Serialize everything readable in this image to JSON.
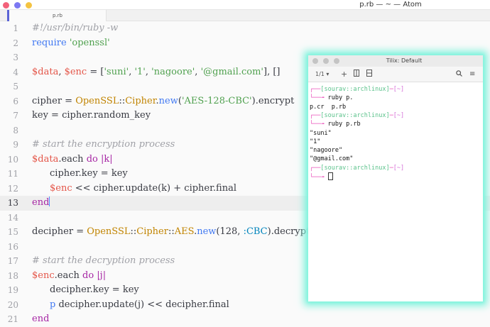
{
  "atom": {
    "window_title": "p.rb — ~ — Atom",
    "tab_label": "p.rb",
    "traffic_lights": [
      "#f2617a",
      "#7b78f2",
      "#f4c342"
    ],
    "cursor_line": 13,
    "lines": [
      {
        "n": "1",
        "tokens": [
          [
            "cm",
            "#!/usr/bin/ruby -w"
          ]
        ]
      },
      {
        "n": "2",
        "tokens": [
          [
            "fn",
            "require"
          ],
          [
            "",
            " "
          ],
          [
            "st",
            "'openssl'"
          ]
        ]
      },
      {
        "n": "3",
        "tokens": []
      },
      {
        "n": "4",
        "tokens": [
          [
            "var",
            "$data"
          ],
          [
            "",
            ", "
          ],
          [
            "var",
            "$enc"
          ],
          [
            "",
            " = ["
          ],
          [
            "st",
            "'suni'"
          ],
          [
            "",
            ", "
          ],
          [
            "st",
            "'1'"
          ],
          [
            "",
            ", "
          ],
          [
            "st",
            "'nagoore'"
          ],
          [
            "",
            ", "
          ],
          [
            "st",
            "'@gmail.com'"
          ],
          [
            "",
            "], []"
          ]
        ]
      },
      {
        "n": "5",
        "tokens": []
      },
      {
        "n": "6",
        "tokens": [
          [
            "",
            "cipher = "
          ],
          [
            "cls",
            "OpenSSL"
          ],
          [
            "",
            "::"
          ],
          [
            "cls",
            "Cipher"
          ],
          [
            "",
            "."
          ],
          [
            "fn",
            "new"
          ],
          [
            "",
            "("
          ],
          [
            "st",
            "'AES-128-CBC'"
          ],
          [
            "",
            ").encrypt"
          ]
        ]
      },
      {
        "n": "7",
        "tokens": [
          [
            "",
            "key = cipher.random_key"
          ]
        ]
      },
      {
        "n": "8",
        "tokens": []
      },
      {
        "n": "9",
        "tokens": [
          [
            "cm",
            "# start the encryption process"
          ]
        ]
      },
      {
        "n": "10",
        "tokens": [
          [
            "var",
            "$data"
          ],
          [
            "",
            ".each "
          ],
          [
            "kw",
            "do"
          ],
          [
            "",
            " "
          ],
          [
            "kw",
            "|k|"
          ]
        ]
      },
      {
        "n": "11",
        "indent": true,
        "tokens": [
          [
            "",
            "cipher.key = key"
          ]
        ]
      },
      {
        "n": "12",
        "indent": true,
        "tokens": [
          [
            "var",
            "$enc"
          ],
          [
            "",
            " << cipher.update(k) + cipher.final"
          ]
        ]
      },
      {
        "n": "13",
        "tokens": [
          [
            "kw",
            "end"
          ]
        ]
      },
      {
        "n": "14",
        "tokens": []
      },
      {
        "n": "15",
        "tokens": [
          [
            "",
            "decipher = "
          ],
          [
            "cls",
            "OpenSSL"
          ],
          [
            "",
            "::"
          ],
          [
            "cls",
            "Cipher"
          ],
          [
            "",
            "::"
          ],
          [
            "cls",
            "AES"
          ],
          [
            "",
            "."
          ],
          [
            "fn",
            "new"
          ],
          [
            "",
            "(128, "
          ],
          [
            "sym",
            ":CBC"
          ],
          [
            "",
            ").decrypt"
          ]
        ]
      },
      {
        "n": "16",
        "tokens": []
      },
      {
        "n": "17",
        "tokens": [
          [
            "cm",
            "# start the decryption process"
          ]
        ]
      },
      {
        "n": "18",
        "tokens": [
          [
            "var",
            "$enc"
          ],
          [
            "",
            ".each "
          ],
          [
            "kw",
            "do"
          ],
          [
            "",
            " "
          ],
          [
            "kw",
            "|j|"
          ]
        ]
      },
      {
        "n": "19",
        "indent": true,
        "tokens": [
          [
            "",
            "decipher.key = key"
          ]
        ]
      },
      {
        "n": "20",
        "indent": true,
        "tokens": [
          [
            "fn",
            "p"
          ],
          [
            "",
            " decipher.update(j) << decipher.final"
          ]
        ]
      },
      {
        "n": "21",
        "tokens": [
          [
            "kw",
            "end"
          ]
        ]
      }
    ]
  },
  "tilix": {
    "title": "Tilix: Default",
    "session_indicator": "1/1",
    "toolbar_icons": [
      "add-icon",
      "split-vertical-icon",
      "split-horizontal-icon",
      "search-icon",
      "menu-icon"
    ],
    "terminal_lines": [
      [
        [
          "pm",
          "┌──"
        ],
        [
          "pr",
          "[sourav::archlinux]"
        ],
        [
          "pm",
          "─"
        ],
        [
          "pt",
          "[~]"
        ]
      ],
      [
        [
          "pm",
          "└──╼ "
        ],
        [
          "",
          "ruby p."
        ]
      ],
      [
        [
          "",
          "p.cr  p.rb"
        ]
      ],
      [
        [
          "pm",
          "┌──"
        ],
        [
          "pr",
          "[sourav::archlinux]"
        ],
        [
          "pm",
          "─"
        ],
        [
          "pt",
          "[~]"
        ]
      ],
      [
        [
          "pm",
          "└──╼ "
        ],
        [
          "",
          "ruby p.rb"
        ]
      ],
      [
        [
          "",
          "\"suni\""
        ]
      ],
      [
        [
          "",
          "\"1\""
        ]
      ],
      [
        [
          "",
          "\"nagoore\""
        ]
      ],
      [
        [
          "",
          "\"@gmail.com\""
        ]
      ],
      [
        [
          "pm",
          "┌──"
        ],
        [
          "pr",
          "[sourav::archlinux]"
        ],
        [
          "pm",
          "─"
        ],
        [
          "pt",
          "[~]"
        ]
      ],
      [
        [
          "pm",
          "└──╼ "
        ],
        [
          "cursor",
          ""
        ]
      ]
    ]
  }
}
